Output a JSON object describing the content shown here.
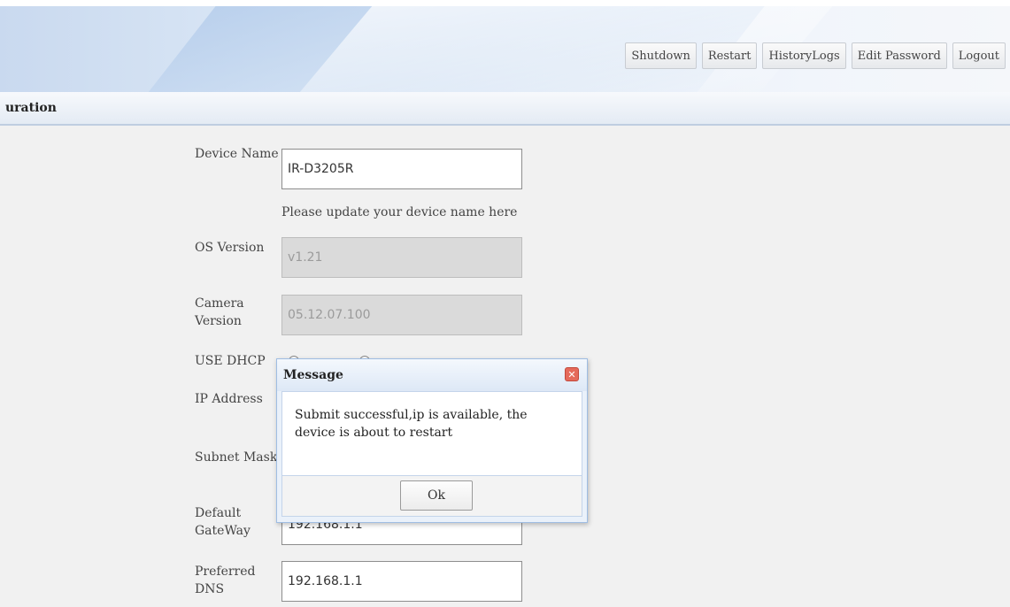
{
  "header": {
    "buttons": [
      {
        "label": "Shutdown"
      },
      {
        "label": "Restart"
      },
      {
        "label": "HistoryLogs"
      },
      {
        "label": "Edit Password"
      },
      {
        "label": "Logout"
      }
    ]
  },
  "page": {
    "title": "uration"
  },
  "form": {
    "device_name": {
      "label": "Device Name",
      "value": "IR-D3205R",
      "hint": "Please update your device name here"
    },
    "os_version": {
      "label": "OS Version",
      "value": "v1.21"
    },
    "camera_version": {
      "label": "Camera Version",
      "value": "05.12.07.100"
    },
    "use_dhcp": {
      "label": "USE DHCP"
    },
    "ip_address": {
      "label": "IP Address"
    },
    "subnet_mask": {
      "label": "Subnet Mask"
    },
    "default_gateway": {
      "label": "Default GateWay",
      "value": "192.168.1.1"
    },
    "preferred_dns": {
      "label": "Preferred DNS",
      "value": "192.168.1.1"
    }
  },
  "modal": {
    "title": "Message",
    "message": "Submit successful,ip is available,   the device is about to restart",
    "ok_label": "Ok",
    "close_icon": "close-icon",
    "close_color": "#e56a5b"
  }
}
